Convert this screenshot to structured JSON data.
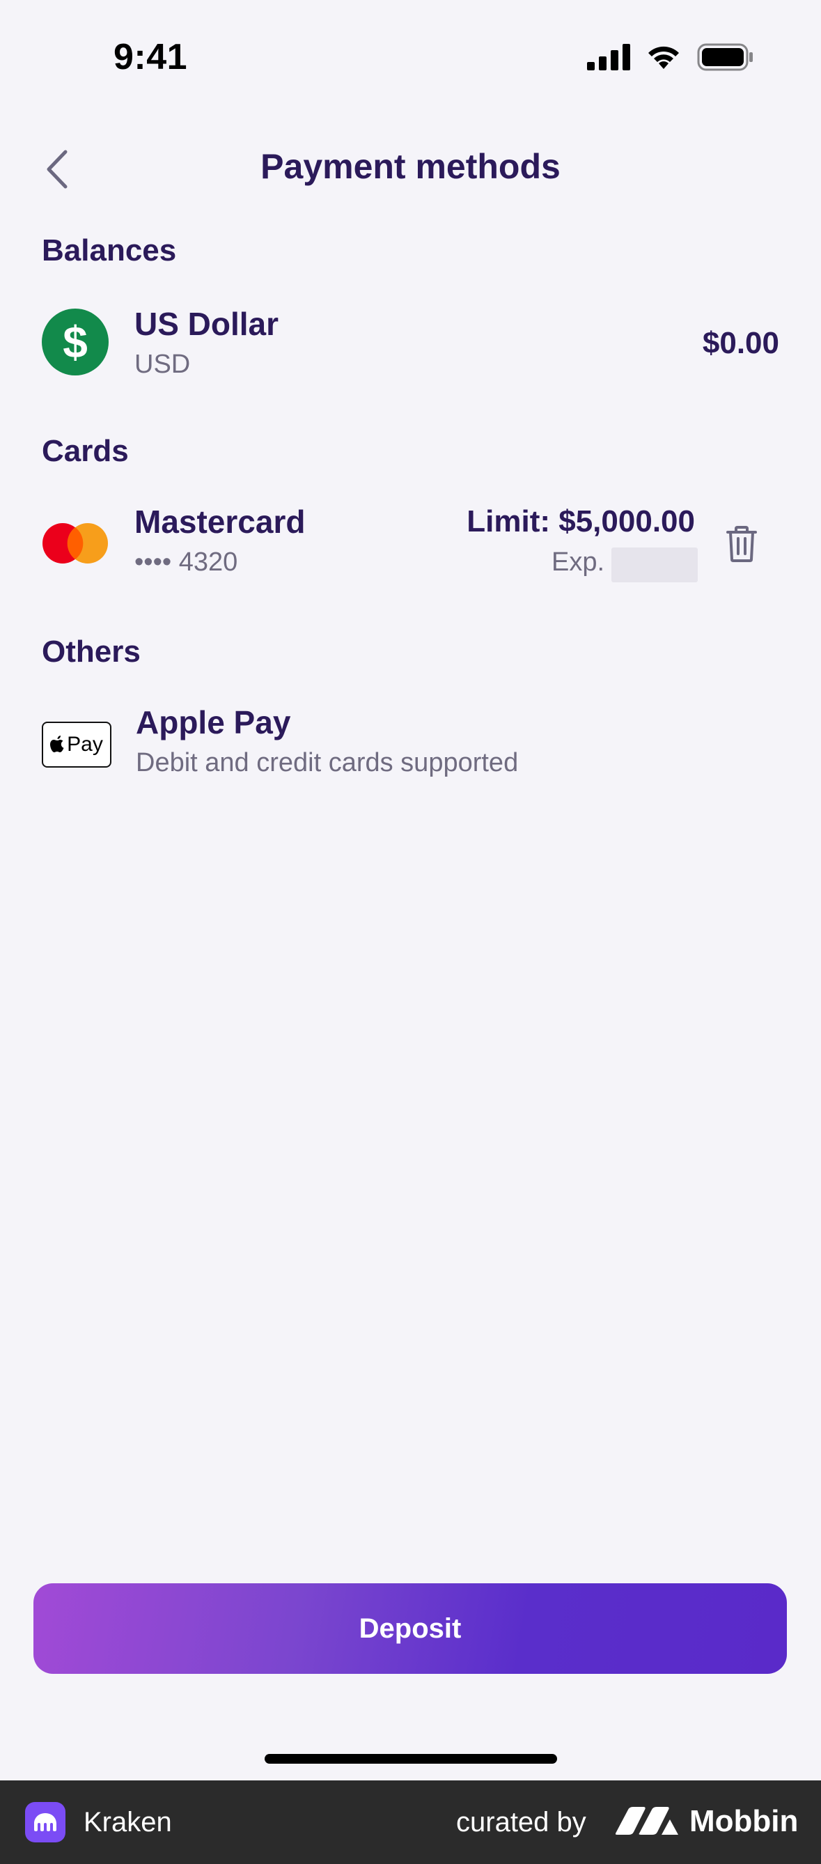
{
  "status_bar": {
    "time": "9:41"
  },
  "header": {
    "title": "Payment methods"
  },
  "balances": {
    "section_title": "Balances",
    "items": [
      {
        "name": "US Dollar",
        "code": "USD",
        "amount": "$0.00",
        "icon": "dollar-icon",
        "symbol": "$"
      }
    ]
  },
  "cards": {
    "section_title": "Cards",
    "items": [
      {
        "name": "Mastercard",
        "number": "•••• 4320",
        "limit": "Limit: $5,000.00",
        "exp_label": "Exp.",
        "icon": "mastercard-icon"
      }
    ]
  },
  "others": {
    "section_title": "Others",
    "items": [
      {
        "name": "Apple Pay",
        "description": "Debit and credit cards supported",
        "icon_text": "Pay"
      }
    ]
  },
  "actions": {
    "deposit_label": "Deposit"
  },
  "footer": {
    "app_name": "Kraken",
    "curated_by": "curated by",
    "brand": "Mobbin"
  },
  "colors": {
    "primary_text": "#2b1a5a",
    "accent_start": "#a14ad6",
    "accent_end": "#5a2ac9",
    "usd_green": "#128a4b"
  }
}
